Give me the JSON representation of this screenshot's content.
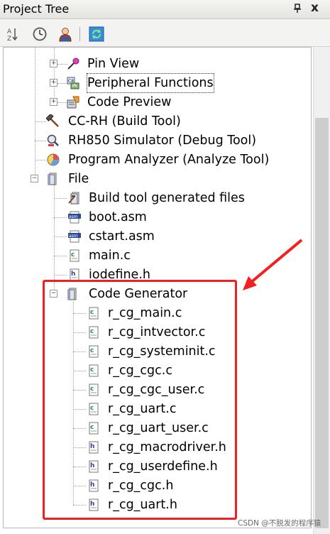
{
  "window": {
    "title": "Project Tree",
    "pin_icon": "pin-icon",
    "close_glyph": "x"
  },
  "toolbar": {
    "buttons": [
      "sort-icon",
      "clock-icon",
      "user-icon",
      "refresh-icon"
    ]
  },
  "tree": {
    "pin_view": "Pin View",
    "peripheral_functions": "Peripheral Functions",
    "code_preview": "Code Preview",
    "build_tool": "CC-RH (Build Tool)",
    "debug_tool": "RH850 Simulator (Debug Tool)",
    "analyze_tool": "Program Analyzer (Analyze Tool)",
    "file": "File",
    "build_generated": "Build tool generated files",
    "boot_asm": "boot.asm",
    "cstart_asm": "cstart.asm",
    "main_c": "main.c",
    "iodefine_h": "iodefine.h",
    "code_generator": "Code Generator",
    "cg_files": [
      "r_cg_main.c",
      "r_cg_intvector.c",
      "r_cg_systeminit.c",
      "r_cg_cgc.c",
      "r_cg_cgc_user.c",
      "r_cg_uart.c",
      "r_cg_uart_user.c",
      "r_cg_macrodriver.h",
      "r_cg_userdefine.h",
      "r_cg_cgc.h",
      "r_cg_uart.h"
    ]
  },
  "colors": {
    "highlight": "#f32020",
    "c_icon": "#2e8b57",
    "h_icon": "#3a3aa8"
  },
  "watermark": "CSDN @不脱发的程序猿"
}
